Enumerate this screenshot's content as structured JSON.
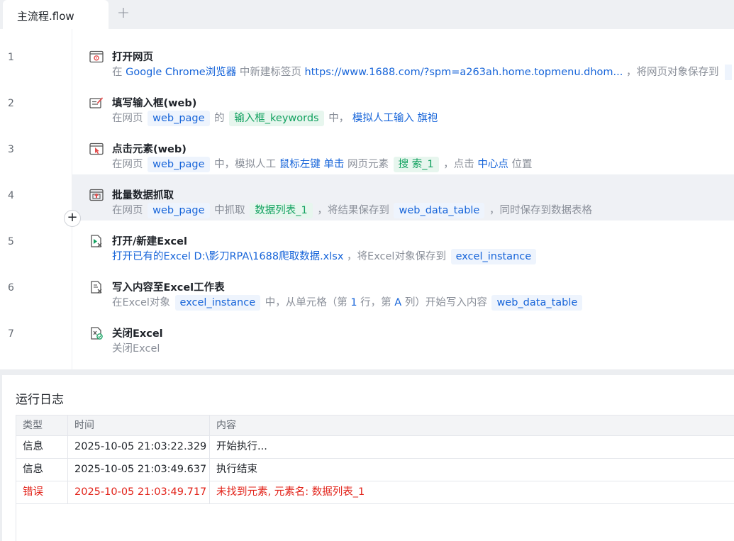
{
  "tabs": [
    {
      "label": "主流程.flow",
      "active": true
    }
  ],
  "tab_add": "+",
  "line_numbers": [
    "1",
    "2",
    "3",
    "4",
    "5",
    "6",
    "7"
  ],
  "add_step": "+",
  "steps": [
    {
      "icon": "browser-open-icon",
      "title": "打开网页",
      "desc": [
        {
          "t": "在 "
        },
        {
          "t": "Google Chrome浏览器",
          "k": "kw"
        },
        {
          "t": " 中新建标签页 "
        },
        {
          "t": "https://www.1688.com/?spm=a263ah.home.topmenu.dhom...",
          "k": "kw"
        },
        {
          "t": " ，将网页对象保存到 "
        }
      ],
      "truncated_var": true
    },
    {
      "icon": "fill-input-icon",
      "title": "填写输入框(web)",
      "desc": [
        {
          "t": "在网页 "
        },
        {
          "t": "web_page",
          "k": "var"
        },
        {
          "t": " 的 "
        },
        {
          "t": "输入框_keywords",
          "k": "el"
        },
        {
          "t": " 中， "
        },
        {
          "t": "模拟人工输入",
          "k": "kw"
        },
        {
          "t": " "
        },
        {
          "t": "旗袍",
          "k": "kw"
        }
      ]
    },
    {
      "icon": "click-element-icon",
      "title": "点击元素(web)",
      "desc": [
        {
          "t": "在网页 "
        },
        {
          "t": "web_page",
          "k": "var"
        },
        {
          "t": " 中，模拟人工 "
        },
        {
          "t": "鼠标左键",
          "k": "kw"
        },
        {
          "t": " "
        },
        {
          "t": "单击",
          "k": "kw"
        },
        {
          "t": " 网页元素 "
        },
        {
          "t": "搜 索_1",
          "k": "el"
        },
        {
          "t": " ，点击 "
        },
        {
          "t": "中心点",
          "k": "kw"
        },
        {
          "t": " 位置"
        }
      ]
    },
    {
      "icon": "batch-scrape-icon",
      "title": "批量数据抓取",
      "highlighted": true,
      "desc": [
        {
          "t": "在网页 "
        },
        {
          "t": "web_page",
          "k": "var"
        },
        {
          "t": " 中抓取 "
        },
        {
          "t": "数据列表_1",
          "k": "el"
        },
        {
          "t": " ，将结果保存到 "
        },
        {
          "t": "web_data_table",
          "k": "var"
        },
        {
          "t": " ，同时保存到数据表格"
        }
      ]
    },
    {
      "icon": "open-excel-icon",
      "title": "打开/新建Excel",
      "desc": [
        {
          "t": "打开已有的Excel",
          "k": "kw"
        },
        {
          "t": "  "
        },
        {
          "t": "D:\\影刀RPA\\1688爬取数据.xlsx",
          "k": "kw"
        },
        {
          "t": " ，将Excel对象保存到 "
        },
        {
          "t": "excel_instance",
          "k": "var"
        }
      ]
    },
    {
      "icon": "write-excel-icon",
      "title": "写入内容至Excel工作表",
      "desc": [
        {
          "t": "在Excel对象 "
        },
        {
          "t": "excel_instance",
          "k": "var"
        },
        {
          "t": " 中，从单元格（第 "
        },
        {
          "t": "1",
          "k": "kw"
        },
        {
          "t": " 行，第 "
        },
        {
          "t": "A",
          "k": "kw"
        },
        {
          "t": " 列）开始写入内容 "
        },
        {
          "t": "web_data_table",
          "k": "var"
        }
      ]
    },
    {
      "icon": "close-excel-icon",
      "title": "关闭Excel",
      "desc": [
        {
          "t": "关闭Excel"
        }
      ]
    }
  ],
  "log": {
    "title": "运行日志",
    "columns": [
      "类型",
      "时间",
      "内容"
    ],
    "rows": [
      {
        "type": "信息",
        "time": "2025-10-05 21:03:22.329",
        "content": "开始执行...",
        "level": "info"
      },
      {
        "type": "信息",
        "time": "2025-10-05 21:03:49.637",
        "content": "执行结束",
        "level": "info"
      },
      {
        "type": "错误",
        "time": "2025-10-05 21:03:49.717",
        "content": "未找到元素, 元素名: 数据列表_1",
        "level": "error"
      }
    ]
  },
  "colors": {
    "link_blue": "#1664d9",
    "element_green": "#11a15f",
    "error_red": "#e2231a",
    "icon_red": "#e34d4d"
  }
}
